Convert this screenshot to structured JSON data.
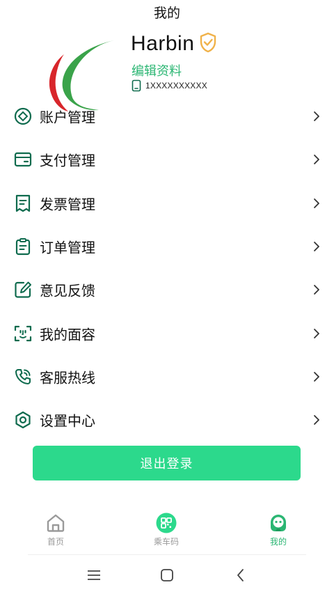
{
  "header": {
    "title": "我的"
  },
  "profile": {
    "username": "Harbin",
    "edit_label": "编辑资料",
    "phone": "1XXXXXXXXXX",
    "verified_icon": "shield-check-icon"
  },
  "menu": {
    "items": [
      {
        "label": "账户管理",
        "icon": "account-icon"
      },
      {
        "label": "支付管理",
        "icon": "wallet-icon"
      },
      {
        "label": "发票管理",
        "icon": "invoice-icon"
      },
      {
        "label": "订单管理",
        "icon": "clipboard-icon"
      },
      {
        "label": "意见反馈",
        "icon": "edit-icon"
      },
      {
        "label": "我的面容",
        "icon": "face-scan-icon"
      },
      {
        "label": "客服热线",
        "icon": "phone-call-icon"
      },
      {
        "label": "设置中心",
        "icon": "settings-icon"
      }
    ]
  },
  "logout_label": "退出登录",
  "tabbar": {
    "home": "首页",
    "code": "乘车码",
    "mine": "我的"
  },
  "colors": {
    "accent": "#2bb673",
    "button": "#2cd98c",
    "icon_dark": "#0f6b4e",
    "verify": "#f0b24a",
    "logo_red": "#d8262b",
    "logo_green": "#3aa34a"
  }
}
